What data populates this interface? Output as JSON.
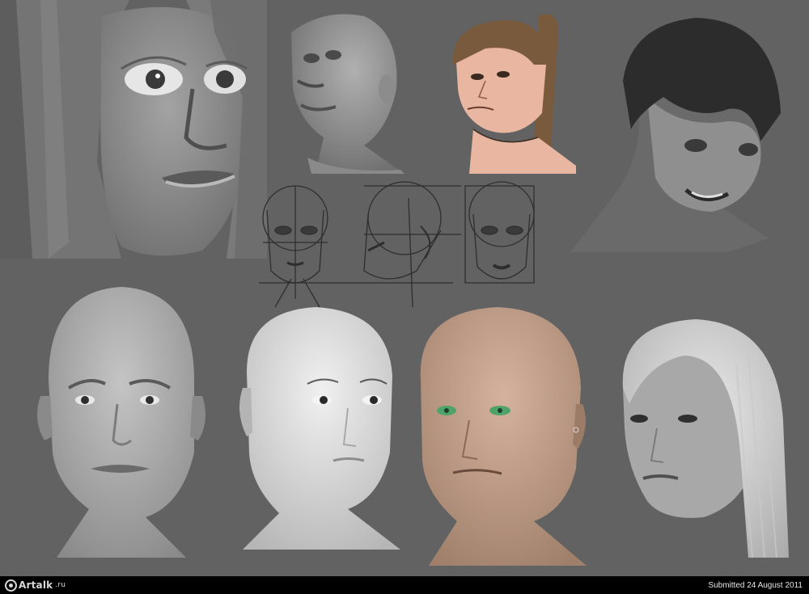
{
  "footer": {
    "logo_text": "Artalk",
    "logo_suffix": ".ru",
    "submitted": "Submitted 24 August 2011"
  },
  "colors": {
    "background": "#626262",
    "footer": "#000000",
    "skin_peach": "#e8b6a1",
    "skin_tan": "#b79883",
    "hair_brown": "#7a5a3c",
    "hair_dark": "#2c2c2c",
    "eye_green": "#4fa36a"
  },
  "artworks": [
    {
      "name": "large-female-face-closeup",
      "style": "grayscale"
    },
    {
      "name": "bald-head-three-quarter-up",
      "style": "grayscale"
    },
    {
      "name": "ponytail-girl-sketch",
      "style": "color"
    },
    {
      "name": "dark-hair-boy-smiling",
      "style": "grayscale"
    },
    {
      "name": "head-construction-front",
      "style": "line-sketch"
    },
    {
      "name": "head-construction-side",
      "style": "line-sketch"
    },
    {
      "name": "head-construction-front-2",
      "style": "line-sketch"
    },
    {
      "name": "bald-male-head-front",
      "style": "grayscale"
    },
    {
      "name": "bald-female-head-light",
      "style": "grayscale"
    },
    {
      "name": "bald-head-tan-green-eyes",
      "style": "color"
    },
    {
      "name": "white-hair-female-head",
      "style": "grayscale"
    }
  ]
}
